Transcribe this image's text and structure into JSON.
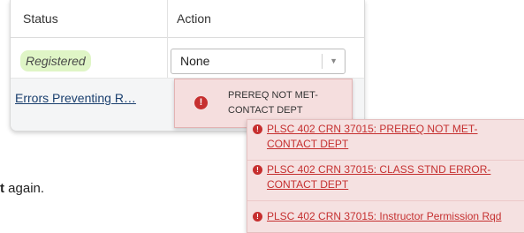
{
  "table": {
    "headers": {
      "status": "Status",
      "action": "Action"
    },
    "row1": {
      "status_badge": "Registered",
      "action_select": {
        "selected": "None",
        "caret": "▼"
      }
    },
    "row2": {
      "errors_link": "Errors Preventing R…"
    }
  },
  "tooltip": {
    "icon": "!",
    "message": "PREREQ NOT MET- CONTACT DEPT"
  },
  "error_panel": {
    "items": [
      {
        "icon": "!",
        "text": "PLSC 402 CRN 37015: PREREQ NOT MET- CONTACT DEPT"
      },
      {
        "icon": "!",
        "text": "PLSC 402 CRN 37015: CLASS STND ERROR- CONTACT DEPT"
      },
      {
        "icon": "!",
        "text": "PLSC 402 CRN 37015: Instructor Permission Rqd"
      }
    ]
  },
  "background_text": {
    "bold_fragment": "t",
    "rest": " again."
  },
  "colors": {
    "badge_bg": "#dff5c6",
    "link": "#1a3f6e",
    "error_text": "#c53030",
    "error_icon": "#c62f2f",
    "error_bg": "#f5e1e1"
  }
}
